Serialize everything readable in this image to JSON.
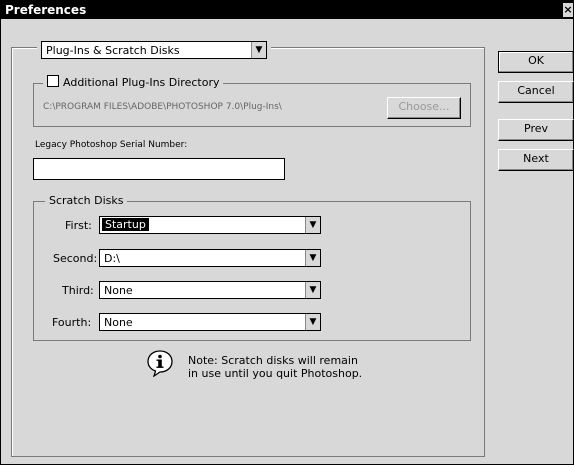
{
  "window": {
    "title": "Preferences",
    "close_glyph": "×"
  },
  "category_select": {
    "value": "Plug-Ins & Scratch Disks",
    "arrow": "▼"
  },
  "plugins_group": {
    "checkbox_label": "Additional Plug-Ins Directory",
    "checked": false,
    "path": "C:\\PROGRAM FILES\\ADOBE\\PHOTOSHOP 7.0\\Plug-Ins\\",
    "choose_label": "Choose..."
  },
  "serial": {
    "label": "Legacy Photoshop Serial Number:",
    "value": ""
  },
  "scratch": {
    "legend": "Scratch Disks",
    "rows": [
      {
        "label": "First:",
        "value": "Startup"
      },
      {
        "label": "Second:",
        "value": "D:\\"
      },
      {
        "label": "Third:",
        "value": "None"
      },
      {
        "label": "Fourth:",
        "value": "None"
      }
    ]
  },
  "note": {
    "line1": "Note: Scratch disks will remain",
    "line2": "in use until you quit Photoshop.",
    "icon": "info-icon"
  },
  "buttons": {
    "ok": "OK",
    "cancel": "Cancel",
    "prev": "Prev",
    "next": "Next"
  }
}
